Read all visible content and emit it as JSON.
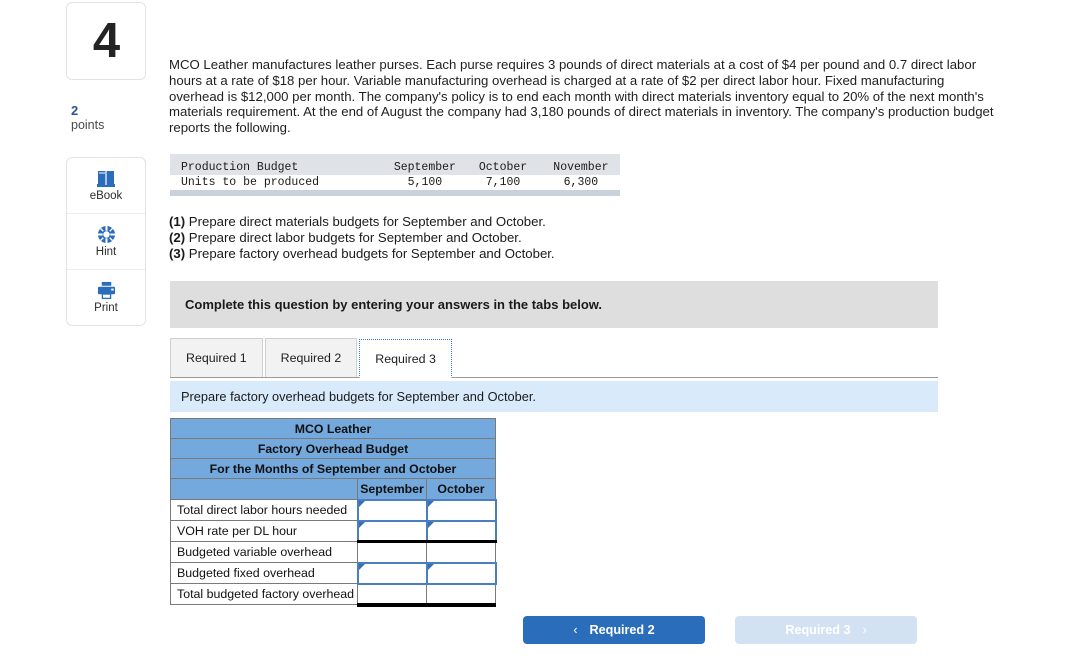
{
  "question": {
    "number": "4",
    "points_value": "2",
    "points_label": "points",
    "stem": "MCO Leather manufactures leather purses. Each purse requires 3 pounds of direct materials at a cost of $4 per pound and 0.7 direct labor hours at a rate of $18 per hour. Variable manufacturing overhead is charged at a rate of $2 per direct labor hour. Fixed manufacturing overhead is $12,000 per month. The company's policy is to end each month with direct materials inventory equal to 20% of the next month's materials requirement. At the end of August the company had 3,180 pounds of direct materials in inventory. The company's production budget reports the following."
  },
  "tools": [
    {
      "label": "eBook",
      "icon": "ebook-icon"
    },
    {
      "label": "Hint",
      "icon": "hint-icon"
    },
    {
      "label": "Print",
      "icon": "print-icon"
    }
  ],
  "production_budget": {
    "header": [
      "Production Budget",
      "September",
      "October",
      "November"
    ],
    "row": [
      "Units to be produced",
      "5,100",
      "7,100",
      "6,300"
    ]
  },
  "requirements": [
    {
      "num": "(1)",
      "text": "Prepare direct materials budgets for September and October."
    },
    {
      "num": "(2)",
      "text": "Prepare direct labor budgets for September and October."
    },
    {
      "num": "(3)",
      "text": "Prepare factory overhead budgets for September and October."
    }
  ],
  "complete_banner": "Complete this question by entering your answers in the tabs below.",
  "tabs": [
    {
      "label": "Required 1",
      "active": false
    },
    {
      "label": "Required 2",
      "active": false
    },
    {
      "label": "Required 3",
      "active": true
    }
  ],
  "req_banner": "Prepare factory overhead budgets for September and October.",
  "answer_table": {
    "title_lines": [
      "MCO Leather",
      "Factory Overhead Budget",
      "For the Months of September and October"
    ],
    "column_headers": [
      "",
      "September",
      "October"
    ],
    "rows": [
      {
        "label": "Total direct labor hours needed",
        "september": "",
        "october": "",
        "editable": true
      },
      {
        "label": "VOH rate per DL hour",
        "september": "",
        "october": "",
        "editable": true
      },
      {
        "label": "Budgeted variable overhead",
        "september": "",
        "october": "",
        "editable": false
      },
      {
        "label": "Budgeted fixed overhead",
        "september": "",
        "october": "",
        "editable": true
      },
      {
        "label": "Total budgeted factory overhead",
        "september": "",
        "october": "",
        "editable": false
      }
    ]
  },
  "nav": {
    "prev_label": "Required 2",
    "prev_chevron": "‹",
    "next_label": "Required 3",
    "next_chevron": "›"
  },
  "colors": {
    "table_header_blue": "#74a9de",
    "banner_gray": "#dedede",
    "banner_blue": "#d9eafb",
    "primary_button": "#2a6ebb",
    "disabled_button": "#d3e2f2",
    "icon_blue": "#2a6ebb"
  }
}
